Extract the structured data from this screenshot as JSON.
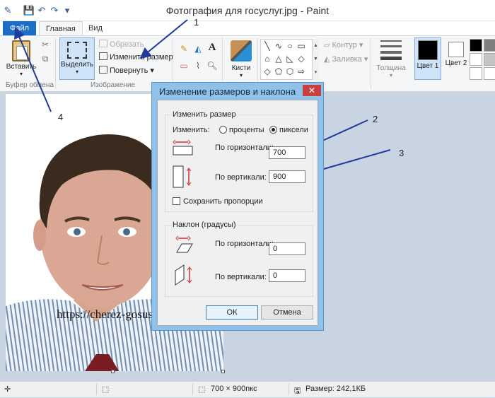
{
  "window": {
    "title": "Фотография для госуслуг.jpg - Paint"
  },
  "tabs": [
    {
      "label": "Файл"
    },
    {
      "label": "Главная"
    },
    {
      "label": "Вид"
    }
  ],
  "ribbon": {
    "clipboard": {
      "paste_label": "Вставить",
      "group_label": "Буфер обмена"
    },
    "image": {
      "select_label": "Выделить",
      "crop_label": "Обрезать",
      "resize_label": "Изменить размер",
      "rotate_label": "Повернуть",
      "group_label": "Изображение"
    },
    "brushes_label": "Кисти",
    "outline_label": "Контур",
    "fill_label": "Заливка",
    "thickness_label": "Толщина",
    "color1_label": "Цвет 1",
    "color2_label": "Цвет 2",
    "color1": "#000000",
    "color2": "#ffffff"
  },
  "dialog": {
    "title": "Изменение размеров и наклона",
    "close_glyph": "✕",
    "resize": {
      "legend": "Изменить размер",
      "by_label": "Изменить:",
      "percent_label": "проценты",
      "pixels_label": "пиксели",
      "horizontal_label": "По горизонтали:",
      "horizontal_value": "700",
      "vertical_label": "По вертикали:",
      "vertical_value": "900",
      "keep_ratio_label": "Сохранить пропорции"
    },
    "skew": {
      "legend": "Наклон (градусы)",
      "horizontal_label": "По горизонтали:",
      "horizontal_value": "0",
      "vertical_label": "По вертикали:",
      "vertical_value": "0"
    },
    "ok_label": "ОК",
    "cancel_label": "Отмена"
  },
  "watermark": "https://cherez-gosuslugi.ru/",
  "annotations": [
    "1",
    "2",
    "3",
    "4"
  ],
  "status": {
    "image_size": "700 × 900пкс",
    "file_size": "Размер: 242,1КБ"
  }
}
